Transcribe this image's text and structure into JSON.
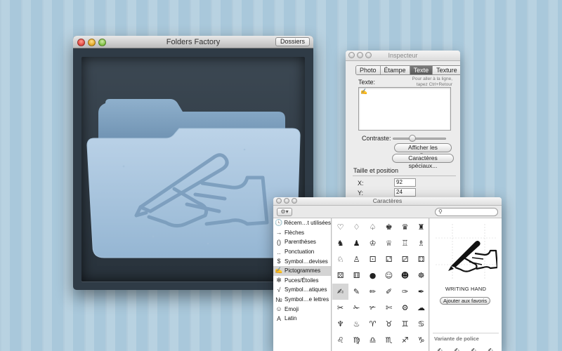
{
  "main_window": {
    "title": "Folders Factory",
    "dossiers_button": "Dossiers"
  },
  "inspector": {
    "title": "Inspecteur",
    "tabs": [
      {
        "label": "Photo",
        "active": false
      },
      {
        "label": "Étampe",
        "active": false
      },
      {
        "label": "Texte",
        "active": true
      },
      {
        "label": "Texture",
        "active": false
      }
    ],
    "text_label": "Texte:",
    "hint": "Pour aller à la ligne, tapez Ctrl+Retour",
    "text_value": "✍",
    "contrast_label": "Contraste:",
    "contrast_level": 0.35,
    "show_fonts_button": "Afficher les polices",
    "special_chars_button": "Caractères spéciaux...",
    "size_position_heading": "Taille et position",
    "x_label": "X:",
    "x_value": "92",
    "y_label": "Y:",
    "y_value": "24"
  },
  "characters": {
    "title": "Caractères",
    "gear_icon": "gear-icon",
    "categories": [
      {
        "icon": "🕓",
        "label": "Récem…t utilisées",
        "selected": false
      },
      {
        "icon": "→",
        "label": "Flèches",
        "selected": false
      },
      {
        "icon": "()",
        "label": "Parenthèses",
        "selected": false
      },
      {
        "icon": "..",
        "label": "Ponctuation",
        "selected": false
      },
      {
        "icon": "$",
        "label": "Symbol…devises",
        "selected": false
      },
      {
        "icon": "✍",
        "label": "Pictogrammes",
        "selected": true
      },
      {
        "icon": "✻",
        "label": "Puces/Étoiles",
        "selected": false
      },
      {
        "icon": "√",
        "label": "Symbol…atiques",
        "selected": false
      },
      {
        "icon": "№",
        "label": "Symbol…e lettres",
        "selected": false
      },
      {
        "icon": "☺",
        "label": "Emoji",
        "selected": false
      },
      {
        "icon": "A",
        "label": "Latin",
        "selected": false
      }
    ],
    "glyphs": [
      "♡",
      "♢",
      "♤",
      "♚",
      "♛",
      "♜",
      "♞",
      "♟",
      "♔",
      "♕",
      "♖",
      "♗",
      "♘",
      "♙",
      "⚀",
      "⚁",
      "⚂",
      "⚃",
      "⚄",
      "⚅",
      "●",
      "☺",
      "☻",
      "☸",
      "✍",
      "✎",
      "✏",
      "✐",
      "✑",
      "✒",
      "✂",
      "✁",
      "✃",
      "✄",
      "⚙",
      "☁",
      "♆",
      "♨",
      "♈",
      "♉",
      "♊",
      "♋",
      "♌",
      "♍",
      "♎",
      "♏",
      "♐",
      "♑",
      "♒",
      "♓",
      "☊",
      "☋",
      "☌",
      "☍"
    ],
    "selected_glyph_index": 24,
    "preview_char": "✍",
    "char_name": "WRITING HAND",
    "add_favorites_button": "Ajouter aux favoris",
    "font_variation_label": "Variante de police",
    "variations": [
      "✍",
      "✍",
      "✍",
      "✍"
    ]
  }
}
